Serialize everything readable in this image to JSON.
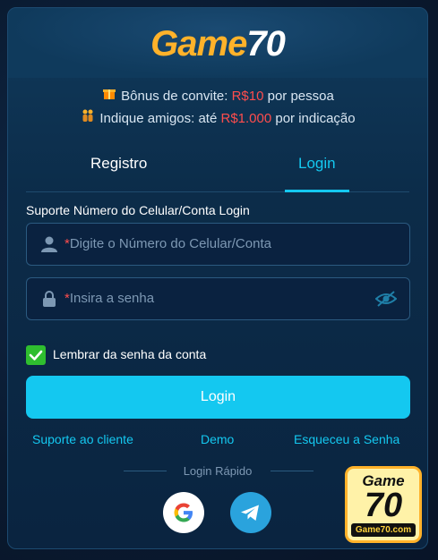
{
  "brand": {
    "logo_part1": "Game",
    "logo_part2": "70"
  },
  "promo": {
    "line1_prefix": "Bônus de convite: ",
    "line1_amount": "R$10",
    "line1_suffix": " por pessoa",
    "line2_prefix": "Indique amigos: até ",
    "line2_amount": "R$1.000",
    "line2_suffix": " por indicação"
  },
  "tabs": {
    "register": "Registro",
    "login": "Login"
  },
  "form": {
    "account_label": "Suporte Número do Celular/Conta Login",
    "account_placeholder": "Digite o Número do Celular/Conta",
    "password_placeholder": "Insira a senha",
    "required_mark": "*",
    "remember_label": "Lembrar da senha da conta",
    "remember_checked": true,
    "login_button": "Login"
  },
  "links": {
    "support": "Suporte ao cliente",
    "demo": "Demo",
    "forgot": "Esqueceu a Senha"
  },
  "quick_login": {
    "label": "Login Rápido",
    "providers": [
      "google",
      "telegram"
    ]
  },
  "badge": {
    "top": "Game",
    "big": "70",
    "url": "Game70.com"
  },
  "colors": {
    "accent": "#14c8f0",
    "gold": "#ffb22a",
    "red": "#ff4d4d",
    "check_green": "#2fbe2f"
  }
}
